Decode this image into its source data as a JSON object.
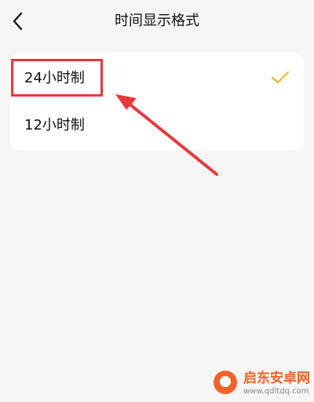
{
  "header": {
    "title": "时间显示格式",
    "back_icon": "chevron-left-icon"
  },
  "options": [
    {
      "label": "24小时制",
      "selected": true
    },
    {
      "label": "12小时制",
      "selected": false
    }
  ],
  "check_icon": "checkmark-icon",
  "colors": {
    "background": "#f5f5f5",
    "card": "#ffffff",
    "check": "#f0b52f",
    "annotation": "#e8383d",
    "watermark": "#f0622a"
  },
  "watermark": {
    "name": "启东安卓网",
    "url": "www.qdltdq.com"
  }
}
